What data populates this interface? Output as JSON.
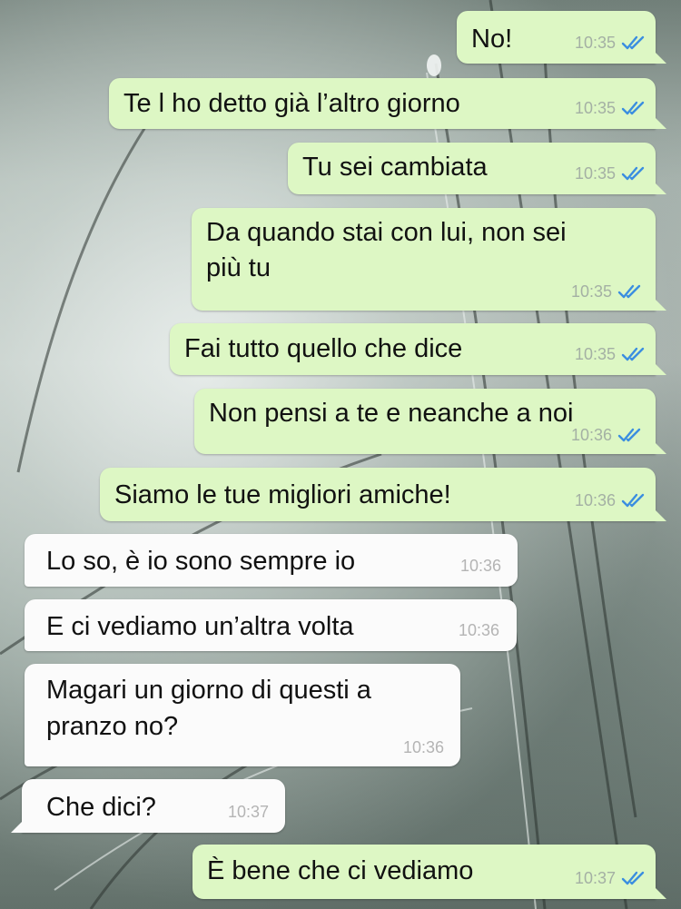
{
  "colors": {
    "outgoing_bubble": "#ddf7c4",
    "incoming_bubble": "#fbfbfb",
    "read_ticks": "#3b8ee0",
    "timestamp": "#a4b0a4"
  },
  "icons": {
    "read_receipt": "double-check-icon"
  },
  "messages": [
    {
      "direction": "outgoing",
      "text": "No!",
      "time": "10:35",
      "status": "read"
    },
    {
      "direction": "outgoing",
      "text": "Te l ho detto già l’altro giorno",
      "time": "10:35",
      "status": "read"
    },
    {
      "direction": "outgoing",
      "text": "Tu sei cambiata",
      "time": "10:35",
      "status": "read"
    },
    {
      "direction": "outgoing",
      "line1": "Da quando stai con lui, non sei",
      "line2": "più tu",
      "time": "10:35",
      "status": "read"
    },
    {
      "direction": "outgoing",
      "text": "Fai tutto quello che dice",
      "time": "10:35",
      "status": "read"
    },
    {
      "direction": "outgoing",
      "text": "Non pensi a te e neanche a noi",
      "time": "10:36",
      "status": "read"
    },
    {
      "direction": "outgoing",
      "text": "Siamo le tue migliori amiche!",
      "time": "10:36",
      "status": "read"
    },
    {
      "direction": "incoming",
      "text": "Lo so, è io sono sempre io",
      "time": "10:36"
    },
    {
      "direction": "incoming",
      "text": "E ci vediamo un’altra volta",
      "time": "10:36"
    },
    {
      "direction": "incoming",
      "line1": "Magari un giorno di questi a",
      "line2": "pranzo no?",
      "time": "10:36"
    },
    {
      "direction": "incoming",
      "text": "Che dici?",
      "time": "10:37"
    },
    {
      "direction": "outgoing",
      "text": "È bene che ci vediamo",
      "time": "10:37",
      "status": "read"
    }
  ]
}
